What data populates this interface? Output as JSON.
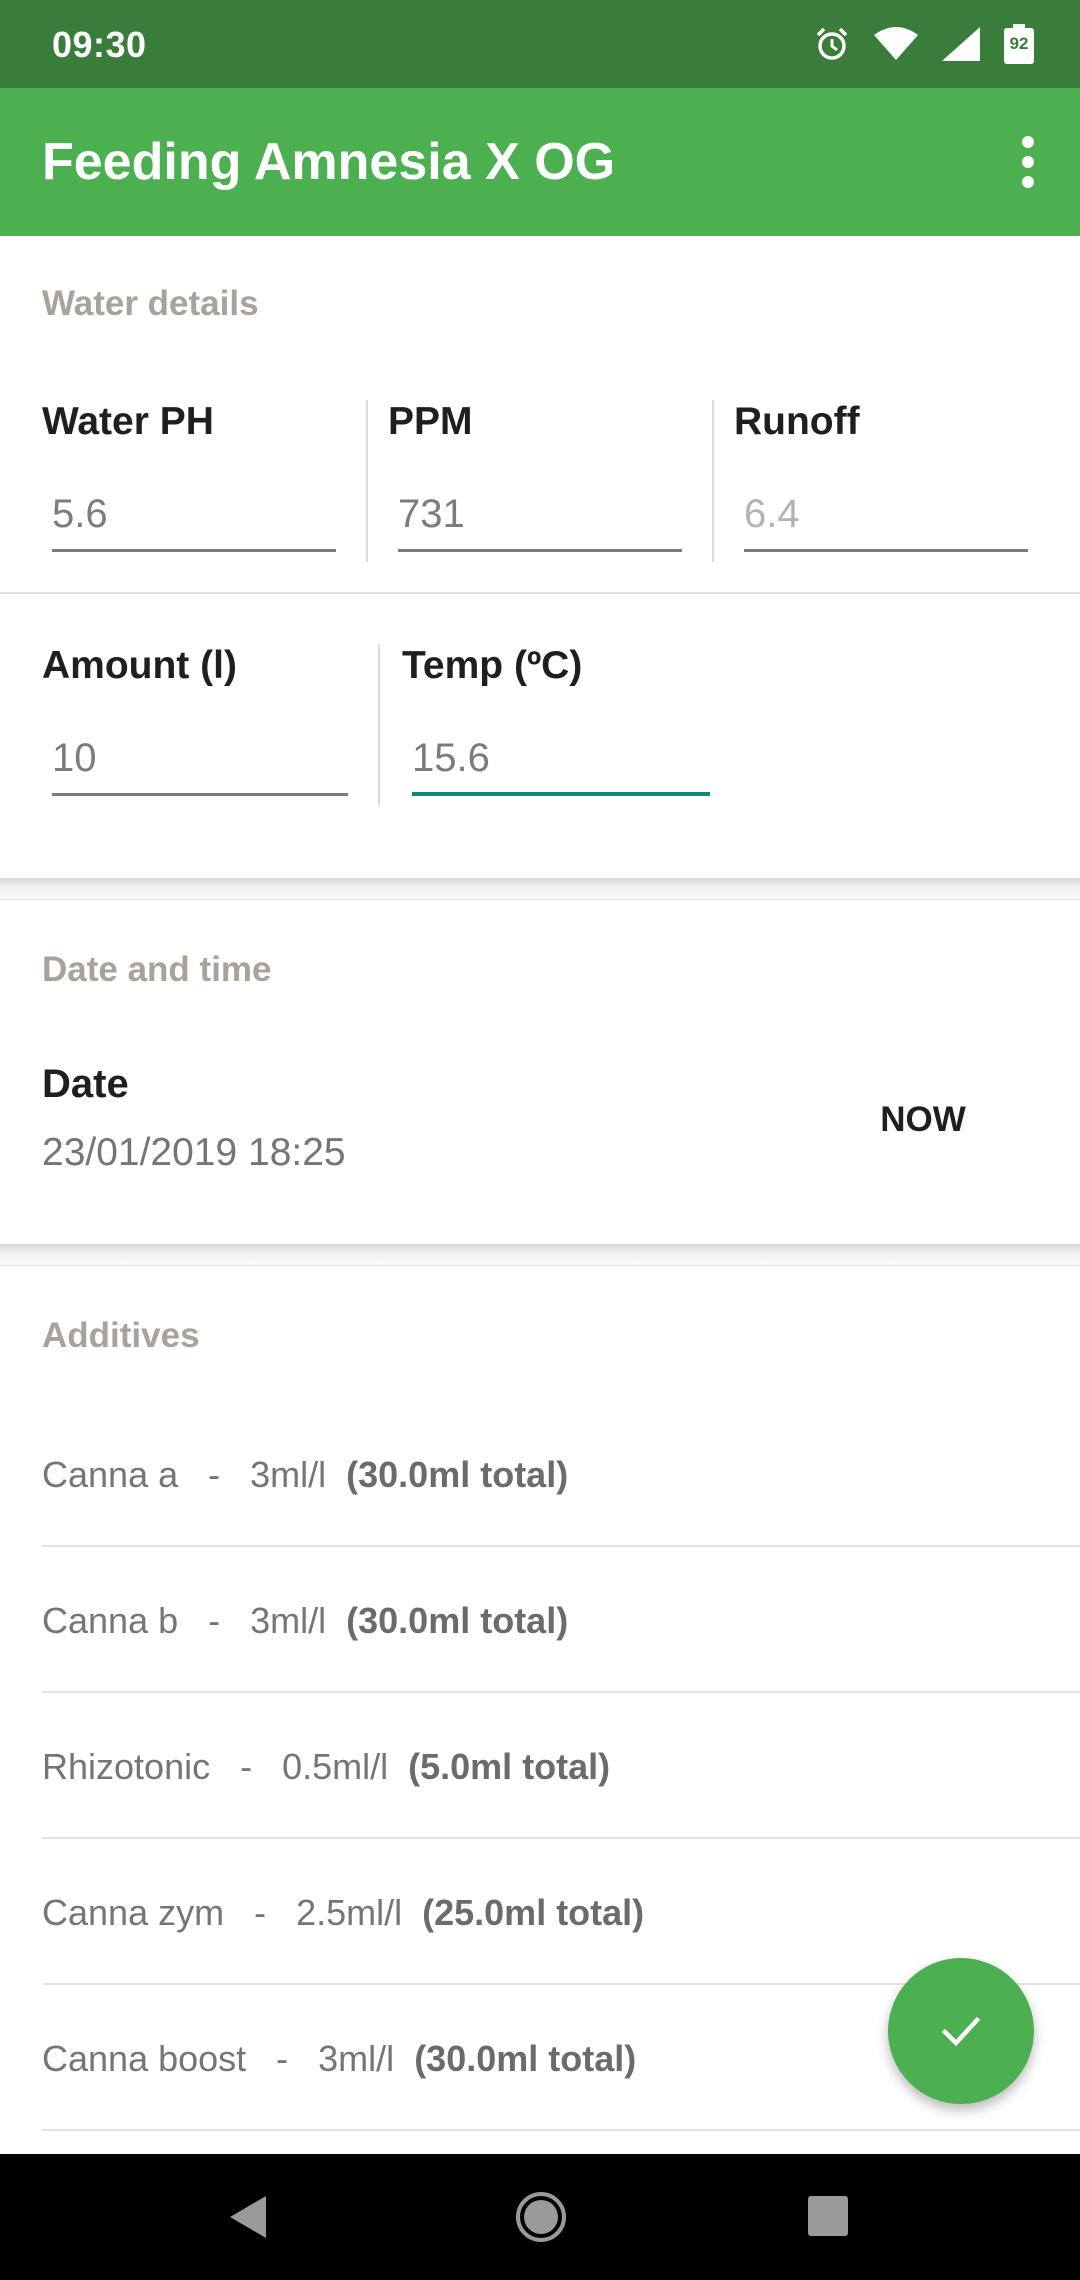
{
  "status_bar": {
    "time": "09:30",
    "battery": "92"
  },
  "app_bar": {
    "title": "Feeding Amnesia X OG"
  },
  "water_details": {
    "section_title": "Water details",
    "water_ph": {
      "label": "Water PH",
      "value": "5.6"
    },
    "ppm": {
      "label": "PPM",
      "value": "731"
    },
    "runoff": {
      "label": "Runoff",
      "placeholder": "6.4"
    },
    "amount": {
      "label": "Amount (l)",
      "value": "10"
    },
    "temp": {
      "label": "Temp (ºC)",
      "value": "15.6"
    }
  },
  "date_time": {
    "section_title": "Date and time",
    "date_label": "Date",
    "date_value": "23/01/2019 18:25",
    "now_label": "NOW"
  },
  "additives": {
    "section_title": "Additives",
    "items": [
      {
        "name": "Canna a",
        "rate": "3ml/l",
        "total": "(30.0ml total)"
      },
      {
        "name": "Canna b",
        "rate": "3ml/l",
        "total": "(30.0ml total)"
      },
      {
        "name": "Rhizotonic",
        "rate": "0.5ml/l",
        "total": "(5.0ml total)"
      },
      {
        "name": "Canna zym",
        "rate": "2.5ml/l",
        "total": "(25.0ml total)"
      },
      {
        "name": "Canna boost",
        "rate": "3ml/l",
        "total": "(30.0ml total)"
      }
    ]
  },
  "colors": {
    "status_bar": "#3a7d3a",
    "app_bar": "#4caf50",
    "accent": "#0f8a7a",
    "section_title": "#a8a29a"
  },
  "icons": {
    "status": [
      "alarm-icon",
      "wifi-icon",
      "signal-icon",
      "battery-icon"
    ],
    "app_bar": "overflow-menu-icon",
    "fab": "check-icon",
    "nav": [
      "back-icon",
      "home-icon",
      "recents-icon"
    ]
  }
}
